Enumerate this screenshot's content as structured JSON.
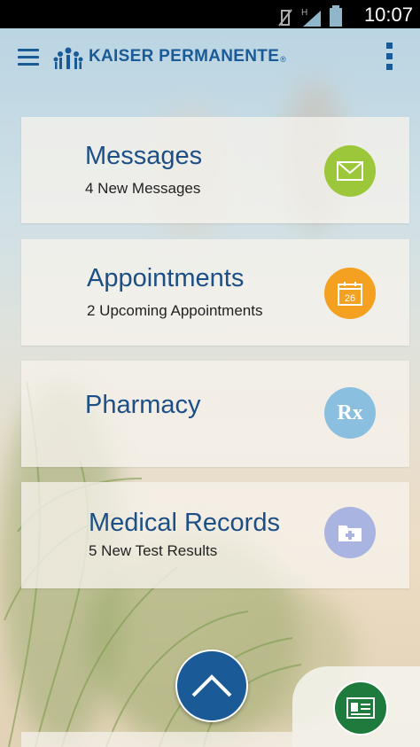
{
  "status_bar": {
    "time": "10:07"
  },
  "app_bar": {
    "logo_text": "KAISER PERMANENTE",
    "logo_mark": "®"
  },
  "cards": [
    {
      "title": "Messages",
      "subtitle": "4 New Messages",
      "icon": "envelope-icon",
      "icon_color": "#9cc73a"
    },
    {
      "title": "Appointments",
      "subtitle": "2 Upcoming Appointments",
      "icon": "calendar-icon",
      "icon_color": "#f4a020",
      "icon_label": "26"
    },
    {
      "title": "Pharmacy",
      "subtitle": "",
      "icon": "rx-icon",
      "icon_color": "#8bbfe0",
      "icon_label": "Rx"
    },
    {
      "title": "Medical Records",
      "subtitle": "5 New Test Results",
      "icon": "medical-folder-icon",
      "icon_color": "#a9b4e0"
    }
  ],
  "colors": {
    "brand_blue": "#1a5a96",
    "card_bg": "#f6f2ec",
    "green_button": "#1f7a3d"
  }
}
